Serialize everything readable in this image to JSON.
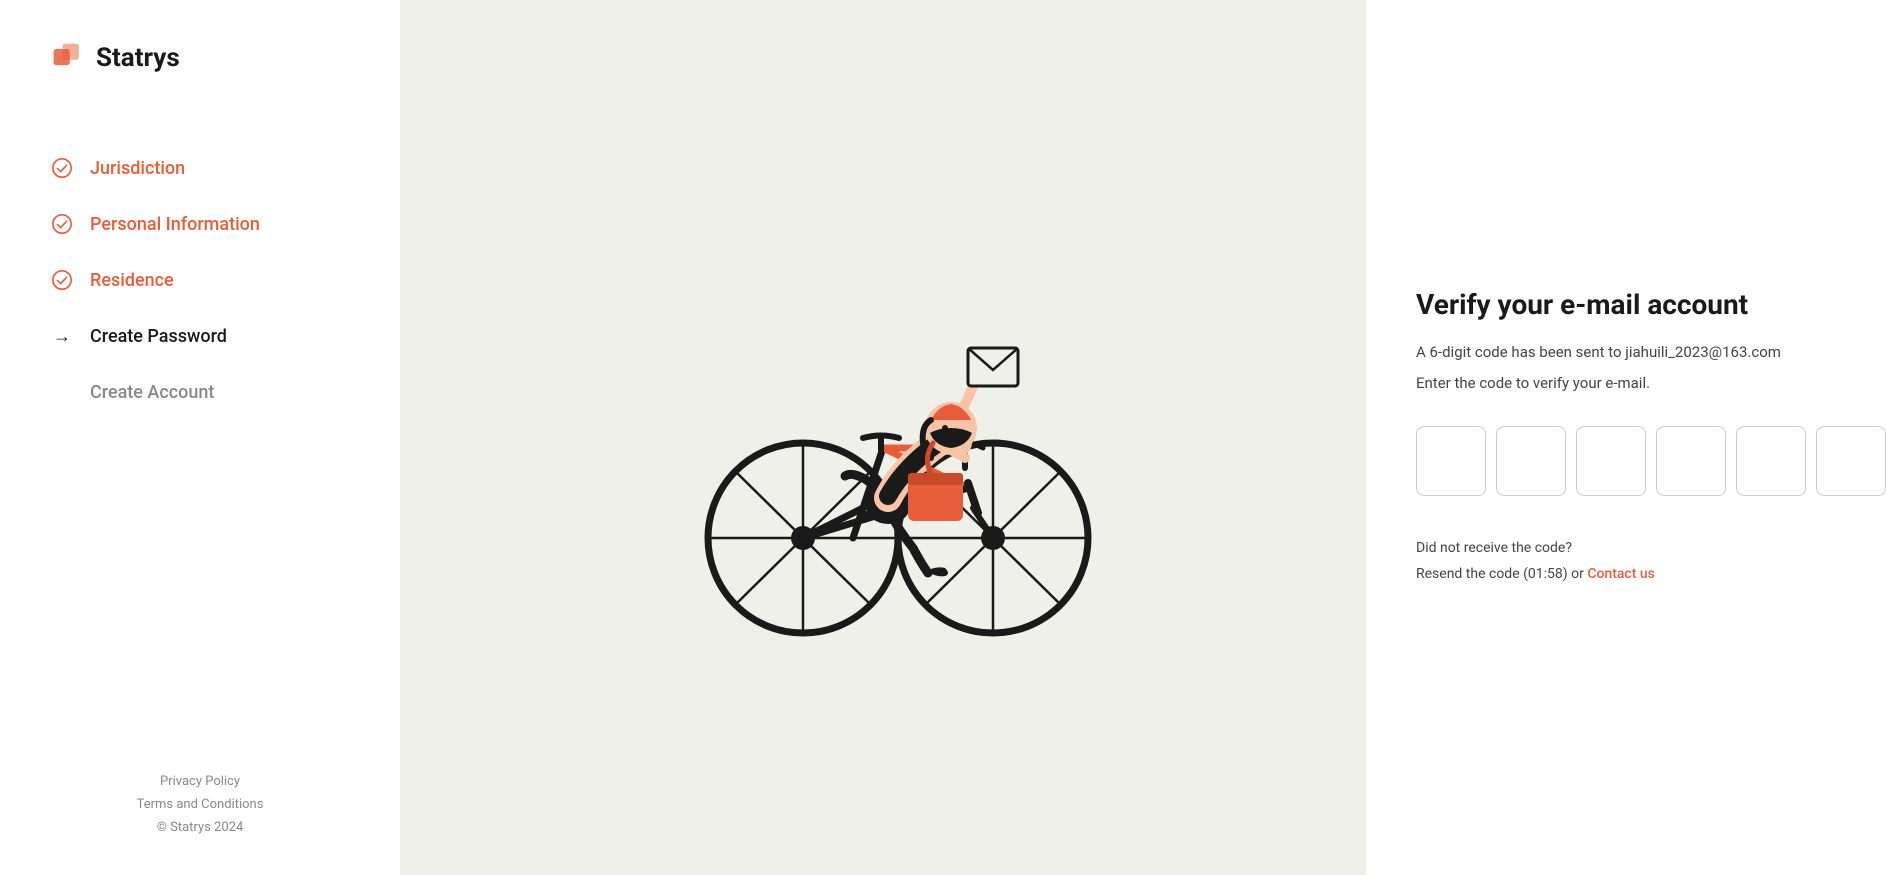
{
  "logo": {
    "text": "Statrys"
  },
  "sidebar": {
    "steps": [
      {
        "id": "jurisdiction",
        "label": "Jurisdiction",
        "state": "completed"
      },
      {
        "id": "personal-information",
        "label": "Personal Information",
        "state": "completed"
      },
      {
        "id": "residence",
        "label": "Residence",
        "state": "completed"
      },
      {
        "id": "create-password",
        "label": "Create Password",
        "state": "active"
      },
      {
        "id": "create-account",
        "label": "Create Account",
        "state": "inactive"
      }
    ],
    "footer": {
      "privacy_policy": "Privacy Policy",
      "terms": "Terms and Conditions",
      "copyright": "© Statrys 2024"
    }
  },
  "verify": {
    "title": "Verify your e-mail account",
    "subtitle": "A 6-digit code has been sent to jiahuili_2023@163.com",
    "instruction": "Enter the code to verify your e-mail.",
    "resend_text": "Did not receive the code?",
    "resend_timer": "Resend the code (01:58) or",
    "contact_us": "Contact us"
  }
}
